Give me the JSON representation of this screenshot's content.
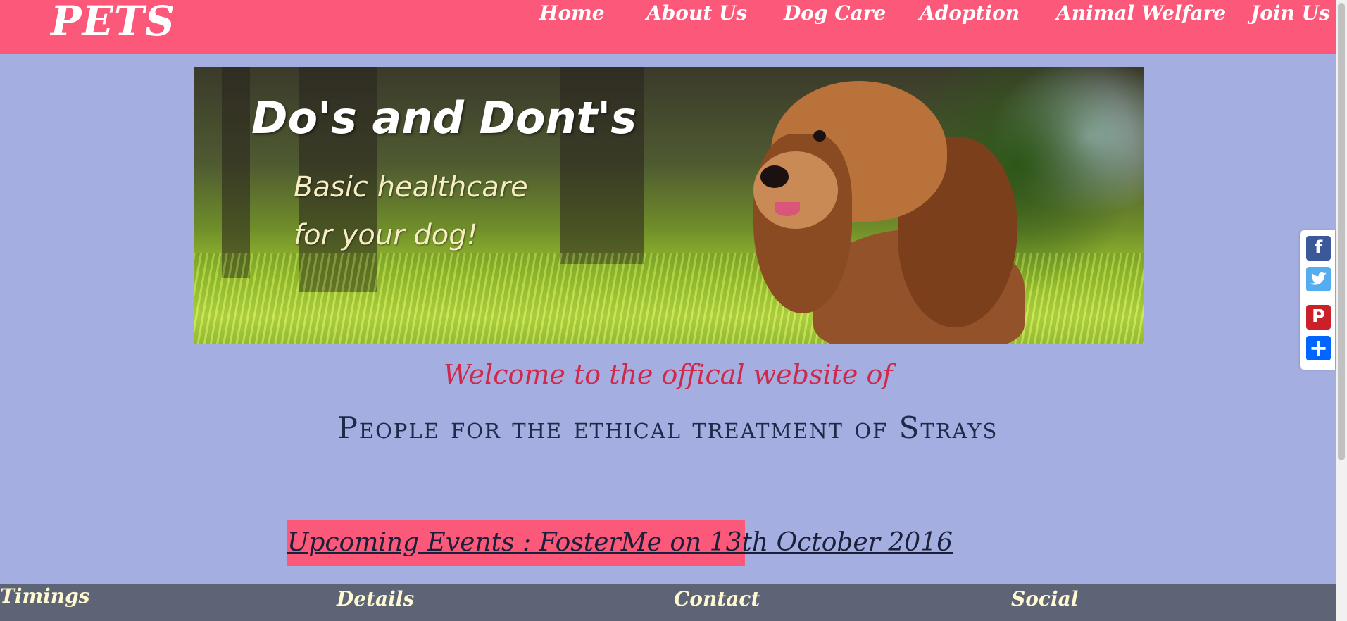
{
  "navbar": {
    "brand": "PETS",
    "links": [
      "Home",
      "About Us",
      "Dog Care",
      "Adoption",
      "Animal Welfare",
      "Join Us"
    ]
  },
  "banner": {
    "title": "Do's and Dont's",
    "subtitle_line1": "Basic healthcare",
    "subtitle_line2": "for your dog!"
  },
  "main": {
    "welcome": "Welcome to the offical website of",
    "org_name": "People for the ethical treatment of Strays",
    "upcoming_events": "Upcoming Events : FosterMe on 13th October 2016"
  },
  "share": {
    "icons": [
      "facebook-icon",
      "twitter-icon",
      "pinterest-icon",
      "share-plus-icon"
    ],
    "colors": {
      "facebook": "#3b5998",
      "twitter": "#55acee",
      "pinterest": "#cb2027",
      "share": "#0166ff"
    }
  },
  "footer": {
    "columns": [
      "Timings",
      "Details",
      "Contact",
      "Social"
    ]
  },
  "theme": {
    "nav_color": "#fc5879",
    "page_bg": "#a4aee0",
    "footer_bg": "#5c6476",
    "welcome_color": "#d0284a"
  }
}
